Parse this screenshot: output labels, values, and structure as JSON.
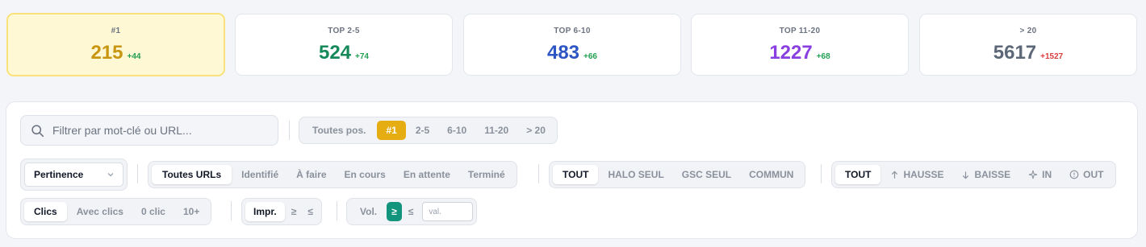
{
  "stats": [
    {
      "label": "#1",
      "value": "215",
      "delta": "+44",
      "color": "#c99612",
      "trend": "up"
    },
    {
      "label": "TOP 2-5",
      "value": "524",
      "delta": "+74",
      "color": "#16895a",
      "trend": "up"
    },
    {
      "label": "TOP 6-10",
      "value": "483",
      "delta": "+66",
      "color": "#2d56c4",
      "trend": "up"
    },
    {
      "label": "TOP 11-20",
      "value": "1227",
      "delta": "+68",
      "color": "#8a3fe0",
      "trend": "up"
    },
    {
      "label": "> 20",
      "value": "5617",
      "delta": "+1527",
      "color": "#5c6877",
      "trend": "down"
    }
  ],
  "search": {
    "placeholder": "Filtrer par mot-clé ou URL..."
  },
  "position_filter": {
    "items": [
      "Toutes pos.",
      "#1",
      "2-5",
      "6-10",
      "11-20",
      "> 20"
    ],
    "selected": "#1"
  },
  "sort_select": {
    "value": "Pertinence"
  },
  "url_status": {
    "items": [
      "Toutes URLs",
      "Identifié",
      "À faire",
      "En cours",
      "En attente",
      "Terminé"
    ],
    "selected": "Toutes URLs"
  },
  "source_filter": {
    "items": [
      "TOUT",
      "HALO SEUL",
      "GSC SEUL",
      "COMMUN"
    ],
    "selected": "TOUT"
  },
  "trend_filter": {
    "items": [
      "TOUT",
      "HAUSSE",
      "BAISSE",
      "IN",
      "OUT"
    ],
    "icons": [
      "",
      "arrow-up-icon",
      "arrow-down-icon",
      "sparkle-icon",
      "circle-info-icon"
    ],
    "selected": "TOUT"
  },
  "clicks_filter": {
    "items": [
      "Clics",
      "Avec clics",
      "0 clic",
      "10+"
    ],
    "selected": "Clics"
  },
  "impr_filter": {
    "items": [
      "Impr.",
      "≥",
      "≤"
    ],
    "selected": "Impr."
  },
  "vol_filter": {
    "label": "Vol.",
    "gte": "≥",
    "lte": "≤",
    "placeholder": "val."
  }
}
